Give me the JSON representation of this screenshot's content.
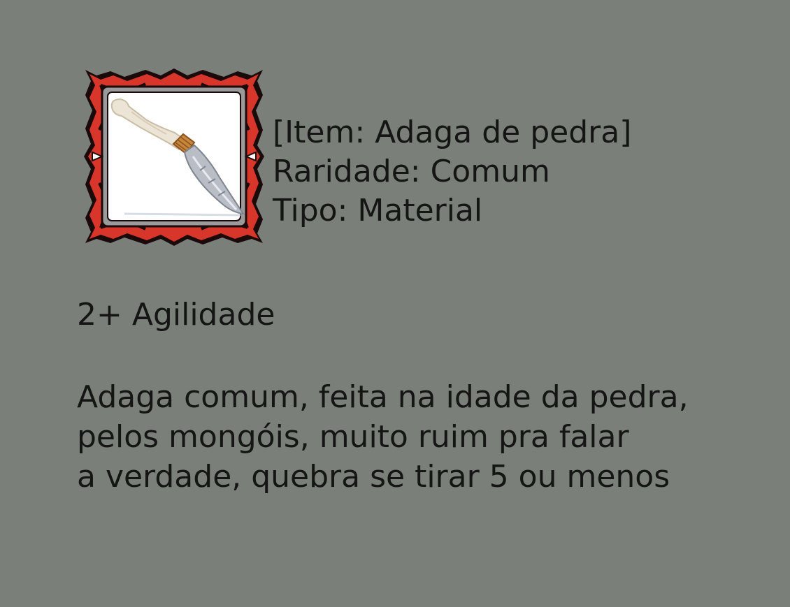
{
  "item": {
    "icon": "stone-dagger-icon",
    "name_line": "[Item: Adaga de pedra]",
    "rarity_line": "Raridade: Comum",
    "type_line": "Tipo: Material"
  },
  "stats": {
    "line": "2+ Agilidade"
  },
  "description": {
    "lines": [
      "Adaga comum, feita na idade da pedra,",
      "pelos mongóis, muito ruim pra falar",
      "a verdade, quebra se tirar 5 ou menos"
    ]
  },
  "colors": {
    "background": "#7b7f79",
    "text": "#141514",
    "frame_red": "#d9362b",
    "frame_outline": "#1a0a0a"
  }
}
